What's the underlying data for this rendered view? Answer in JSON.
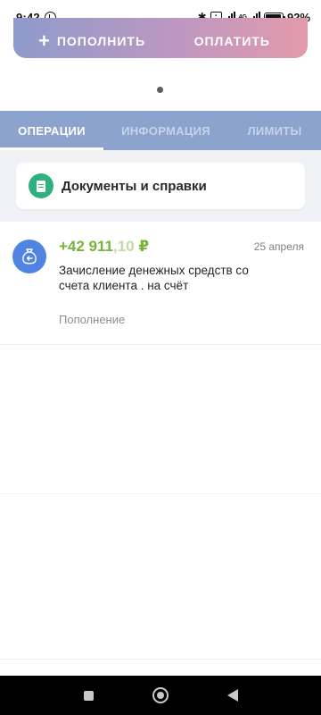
{
  "status_bar": {
    "time": "9:42",
    "network": "4G",
    "battery": "92"
  },
  "actions": {
    "top_up_label": "ПОПОЛНИТЬ",
    "pay_label": "ОПЛАТИТЬ"
  },
  "tabs": [
    {
      "label": "ОПЕРАЦИИ",
      "active": true
    },
    {
      "label": "ИНФОРМАЦИЯ",
      "active": false
    },
    {
      "label": "ЛИМИТЫ",
      "active": false
    }
  ],
  "documents": {
    "label": "Документы и справки",
    "icon": "document-icon"
  },
  "transactions": [
    {
      "amount_main": "+42 911",
      "amount_kopecks": ",10",
      "currency": "₽",
      "date": "25 апреля",
      "description": "Зачисление денежных средств со счета клиента . на счёт",
      "category": "Пополнение",
      "icon": "incoming-money-bag-icon"
    }
  ],
  "colors": {
    "tabs_bg": "#8ca3cd",
    "amount_green": "#78b33a",
    "docs_icon_green": "#2fb17e",
    "txn_icon_blue": "#4f84e3"
  }
}
